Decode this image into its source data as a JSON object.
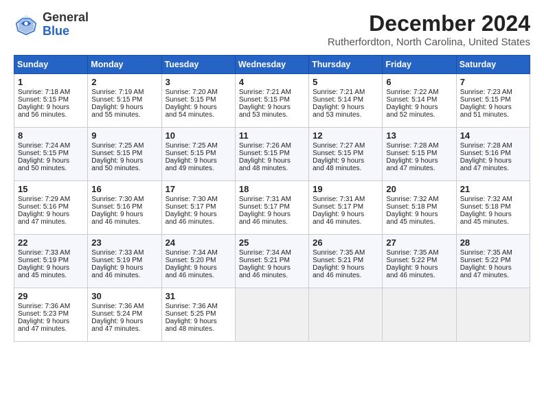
{
  "header": {
    "logo_general": "General",
    "logo_blue": "Blue",
    "title": "December 2024",
    "location": "Rutherfordton, North Carolina, United States"
  },
  "columns": [
    "Sunday",
    "Monday",
    "Tuesday",
    "Wednesday",
    "Thursday",
    "Friday",
    "Saturday"
  ],
  "weeks": [
    [
      {
        "day": "1",
        "lines": [
          "Sunrise: 7:18 AM",
          "Sunset: 5:15 PM",
          "Daylight: 9 hours",
          "and 56 minutes."
        ]
      },
      {
        "day": "2",
        "lines": [
          "Sunrise: 7:19 AM",
          "Sunset: 5:15 PM",
          "Daylight: 9 hours",
          "and 55 minutes."
        ]
      },
      {
        "day": "3",
        "lines": [
          "Sunrise: 7:20 AM",
          "Sunset: 5:15 PM",
          "Daylight: 9 hours",
          "and 54 minutes."
        ]
      },
      {
        "day": "4",
        "lines": [
          "Sunrise: 7:21 AM",
          "Sunset: 5:15 PM",
          "Daylight: 9 hours",
          "and 53 minutes."
        ]
      },
      {
        "day": "5",
        "lines": [
          "Sunrise: 7:21 AM",
          "Sunset: 5:14 PM",
          "Daylight: 9 hours",
          "and 53 minutes."
        ]
      },
      {
        "day": "6",
        "lines": [
          "Sunrise: 7:22 AM",
          "Sunset: 5:14 PM",
          "Daylight: 9 hours",
          "and 52 minutes."
        ]
      },
      {
        "day": "7",
        "lines": [
          "Sunrise: 7:23 AM",
          "Sunset: 5:15 PM",
          "Daylight: 9 hours",
          "and 51 minutes."
        ]
      }
    ],
    [
      {
        "day": "8",
        "lines": [
          "Sunrise: 7:24 AM",
          "Sunset: 5:15 PM",
          "Daylight: 9 hours",
          "and 50 minutes."
        ]
      },
      {
        "day": "9",
        "lines": [
          "Sunrise: 7:25 AM",
          "Sunset: 5:15 PM",
          "Daylight: 9 hours",
          "and 50 minutes."
        ]
      },
      {
        "day": "10",
        "lines": [
          "Sunrise: 7:25 AM",
          "Sunset: 5:15 PM",
          "Daylight: 9 hours",
          "and 49 minutes."
        ]
      },
      {
        "day": "11",
        "lines": [
          "Sunrise: 7:26 AM",
          "Sunset: 5:15 PM",
          "Daylight: 9 hours",
          "and 48 minutes."
        ]
      },
      {
        "day": "12",
        "lines": [
          "Sunrise: 7:27 AM",
          "Sunset: 5:15 PM",
          "Daylight: 9 hours",
          "and 48 minutes."
        ]
      },
      {
        "day": "13",
        "lines": [
          "Sunrise: 7:28 AM",
          "Sunset: 5:15 PM",
          "Daylight: 9 hours",
          "and 47 minutes."
        ]
      },
      {
        "day": "14",
        "lines": [
          "Sunrise: 7:28 AM",
          "Sunset: 5:16 PM",
          "Daylight: 9 hours",
          "and 47 minutes."
        ]
      }
    ],
    [
      {
        "day": "15",
        "lines": [
          "Sunrise: 7:29 AM",
          "Sunset: 5:16 PM",
          "Daylight: 9 hours",
          "and 47 minutes."
        ]
      },
      {
        "day": "16",
        "lines": [
          "Sunrise: 7:30 AM",
          "Sunset: 5:16 PM",
          "Daylight: 9 hours",
          "and 46 minutes."
        ]
      },
      {
        "day": "17",
        "lines": [
          "Sunrise: 7:30 AM",
          "Sunset: 5:17 PM",
          "Daylight: 9 hours",
          "and 46 minutes."
        ]
      },
      {
        "day": "18",
        "lines": [
          "Sunrise: 7:31 AM",
          "Sunset: 5:17 PM",
          "Daylight: 9 hours",
          "and 46 minutes."
        ]
      },
      {
        "day": "19",
        "lines": [
          "Sunrise: 7:31 AM",
          "Sunset: 5:17 PM",
          "Daylight: 9 hours",
          "and 46 minutes."
        ]
      },
      {
        "day": "20",
        "lines": [
          "Sunrise: 7:32 AM",
          "Sunset: 5:18 PM",
          "Daylight: 9 hours",
          "and 45 minutes."
        ]
      },
      {
        "day": "21",
        "lines": [
          "Sunrise: 7:32 AM",
          "Sunset: 5:18 PM",
          "Daylight: 9 hours",
          "and 45 minutes."
        ]
      }
    ],
    [
      {
        "day": "22",
        "lines": [
          "Sunrise: 7:33 AM",
          "Sunset: 5:19 PM",
          "Daylight: 9 hours",
          "and 45 minutes."
        ]
      },
      {
        "day": "23",
        "lines": [
          "Sunrise: 7:33 AM",
          "Sunset: 5:19 PM",
          "Daylight: 9 hours",
          "and 46 minutes."
        ]
      },
      {
        "day": "24",
        "lines": [
          "Sunrise: 7:34 AM",
          "Sunset: 5:20 PM",
          "Daylight: 9 hours",
          "and 46 minutes."
        ]
      },
      {
        "day": "25",
        "lines": [
          "Sunrise: 7:34 AM",
          "Sunset: 5:21 PM",
          "Daylight: 9 hours",
          "and 46 minutes."
        ]
      },
      {
        "day": "26",
        "lines": [
          "Sunrise: 7:35 AM",
          "Sunset: 5:21 PM",
          "Daylight: 9 hours",
          "and 46 minutes."
        ]
      },
      {
        "day": "27",
        "lines": [
          "Sunrise: 7:35 AM",
          "Sunset: 5:22 PM",
          "Daylight: 9 hours",
          "and 46 minutes."
        ]
      },
      {
        "day": "28",
        "lines": [
          "Sunrise: 7:35 AM",
          "Sunset: 5:22 PM",
          "Daylight: 9 hours",
          "and 47 minutes."
        ]
      }
    ],
    [
      {
        "day": "29",
        "lines": [
          "Sunrise: 7:36 AM",
          "Sunset: 5:23 PM",
          "Daylight: 9 hours",
          "and 47 minutes."
        ]
      },
      {
        "day": "30",
        "lines": [
          "Sunrise: 7:36 AM",
          "Sunset: 5:24 PM",
          "Daylight: 9 hours",
          "and 47 minutes."
        ]
      },
      {
        "day": "31",
        "lines": [
          "Sunrise: 7:36 AM",
          "Sunset: 5:25 PM",
          "Daylight: 9 hours",
          "and 48 minutes."
        ]
      },
      {
        "day": "",
        "lines": []
      },
      {
        "day": "",
        "lines": []
      },
      {
        "day": "",
        "lines": []
      },
      {
        "day": "",
        "lines": []
      }
    ]
  ]
}
